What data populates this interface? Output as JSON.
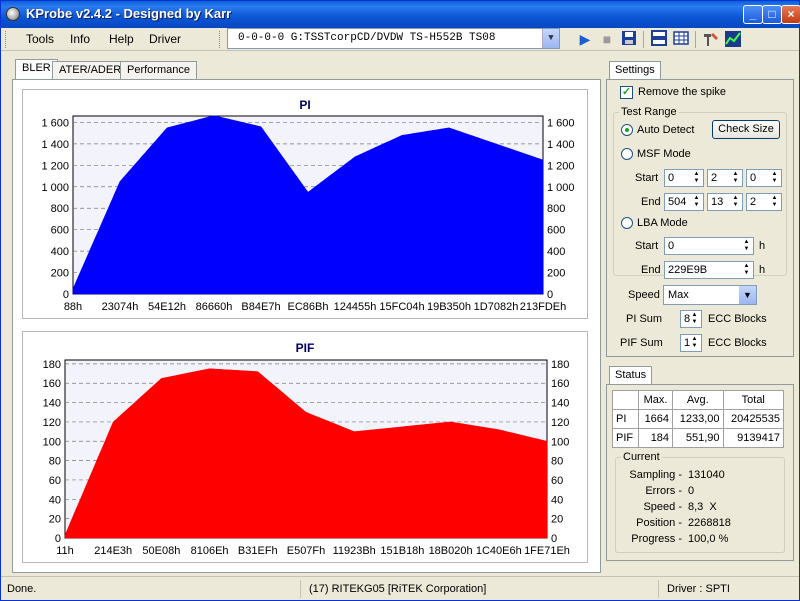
{
  "window": {
    "title": "KProbe v2.4.2 - Designed by Karr"
  },
  "menu": [
    "Tools",
    "Info",
    "Help",
    "Driver"
  ],
  "toolbar": {
    "drive": "0-0-0-0 G:TSSTcorpCD/DVDW TS-H552B TS08"
  },
  "tabs": [
    "BLER",
    "ATER/ADER",
    "Performance"
  ],
  "pi_chart": {
    "title": "PI",
    "y_ticks": [
      "0",
      "200",
      "400",
      "600",
      "800",
      "1 000",
      "1 200",
      "1 400",
      "1 600"
    ],
    "x_ticks": [
      "88h",
      "23074h",
      "54E12h",
      "86660h",
      "B84E7h",
      "EC86Bh",
      "124455h",
      "15FC04h",
      "19B350h",
      "1D7082h",
      "213FDEh"
    ]
  },
  "pif_chart": {
    "title": "PIF",
    "y_ticks": [
      "0",
      "20",
      "40",
      "60",
      "80",
      "100",
      "120",
      "140",
      "160",
      "180"
    ],
    "x_ticks": [
      "11h",
      "214E3h",
      "50E08h",
      "8106Eh",
      "B31EFh",
      "E507Fh",
      "11923Bh",
      "151B18h",
      "18B020h",
      "1C40E6h",
      "1FE71Eh"
    ]
  },
  "chart_data": [
    {
      "type": "area",
      "title": "PI",
      "ylim": [
        0,
        1660
      ],
      "x": [
        "88h",
        "23074h",
        "54E12h",
        "86660h",
        "B84E7h",
        "EC86Bh",
        "124455h",
        "15FC04h",
        "19B350h",
        "1D7082h",
        "213FDEh"
      ],
      "values": [
        50,
        1050,
        1550,
        1664,
        1560,
        950,
        1280,
        1480,
        1550,
        1400,
        1250
      ],
      "color": "#0000ff"
    },
    {
      "type": "area",
      "title": "PIF",
      "ylim": [
        0,
        184
      ],
      "x": [
        "11h",
        "214E3h",
        "50E08h",
        "8106Eh",
        "B31EFh",
        "E507Fh",
        "11923Bh",
        "151B18h",
        "18B020h",
        "1C40E6h",
        "1FE71Eh"
      ],
      "values": [
        3,
        120,
        165,
        175,
        172,
        130,
        110,
        115,
        120,
        112,
        100
      ],
      "color": "#ff0000"
    }
  ],
  "settings": {
    "tab_label": "Settings",
    "remove_spike": "Remove the spike",
    "test_range": "Test Range",
    "auto_detect": "Auto Detect",
    "check_size": "Check Size",
    "msf_mode": "MSF Mode",
    "start_label": "Start",
    "end_label": "End",
    "msf_start": [
      "0",
      "2",
      "0"
    ],
    "msf_end": [
      "504",
      "13",
      "2"
    ],
    "lba_mode": "LBA Mode",
    "lba_start": "0",
    "lba_end": "229E9B",
    "h": "h",
    "speed_label": "Speed",
    "speed_value": "Max",
    "pi_sum_label": "PI Sum",
    "pi_sum_value": "8",
    "pif_sum_label": "PIF Sum",
    "pif_sum_value": "1",
    "ecc_blocks": "ECC Blocks"
  },
  "status": {
    "tab_label": "Status",
    "headers": [
      "Max.",
      "Avg.",
      "Total"
    ],
    "rows": [
      {
        "name": "PI",
        "max": "1664",
        "avg": "1233,00",
        "total": "20425535"
      },
      {
        "name": "PIF",
        "max": "184",
        "avg": "551,90",
        "total": "9139417"
      }
    ],
    "current_label": "Current",
    "sampling_label": "Sampling -",
    "sampling_value": "131040",
    "errors_label": "Errors -",
    "errors_value": "0",
    "speed_label": "Speed -",
    "speed_value": "8,3  X",
    "position_label": "Position -",
    "position_value": "2268818",
    "progress_label": "Progress -",
    "progress_value": "100,0 %"
  },
  "statusbar": {
    "left": "Done.",
    "disc": "(17) RITEKG05 [RiTEK Corporation]",
    "driver": "Driver : SPTI"
  }
}
